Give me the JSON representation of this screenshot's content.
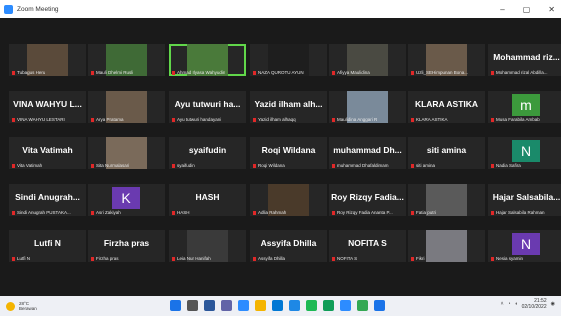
{
  "window": {
    "title": "Zoom Meeting",
    "controls": [
      "–",
      "▢",
      "✕"
    ]
  },
  "tiles": [
    {
      "big": "",
      "small": "Tubagus Heru",
      "video": "#5a4a3a"
    },
    {
      "big": "",
      "small": "Mauli Dhelmi Rusli",
      "video": "#3f6a36"
    },
    {
      "big": "",
      "small": "Ahmad Ilyasa Wahyudin",
      "video": "#4a7a3a",
      "active": true
    },
    {
      "big": "",
      "small": "NAZA QUROTU AYUN",
      "video": "#1e1e1e"
    },
    {
      "big": "",
      "small": "Afiyya Maulidina",
      "video": "#4a4a42"
    },
    {
      "big": "",
      "small": "Uzli_SEHimpunan Bona...",
      "video": "#6a5a4a"
    },
    {
      "big": "Mohammad riz...",
      "small": "Mohammad rizal Abdilla..."
    },
    {
      "big": "VINA WAHYU L...",
      "small": "VINA WAHYU LESTARI"
    },
    {
      "big": "",
      "small": "Arya Pratama",
      "video": "#6a5a4a"
    },
    {
      "big": "Ayu tutwuri ha...",
      "small": "Ayu tutwuri handayani"
    },
    {
      "big": "Yazid ilham alh...",
      "small": "Yazid ilham alhaqq"
    },
    {
      "big": "",
      "small": "Maulidina Anggari R",
      "video": "#7a8a9a"
    },
    {
      "big": "KLARA ASTIKA",
      "small": "KLARA ASTIKA"
    },
    {
      "big": "m",
      "small": "Musa Farabila Ambab",
      "avatar": "#3c9a3c"
    },
    {
      "big": "Vita Vatimah",
      "small": "Vita Vatimah"
    },
    {
      "big": "",
      "small": "Sita Nurmalasari",
      "video": "#7a6a5a"
    },
    {
      "big": "syaifudin",
      "small": "syaifudin"
    },
    {
      "big": "Roqi Wildana",
      "small": "Roqi Wildana"
    },
    {
      "big": "muhammad Dh...",
      "small": "muhammad Dhafaldimam"
    },
    {
      "big": "siti amina",
      "small": "siti amina"
    },
    {
      "big": "N",
      "small": "Nadia Safira",
      "avatar": "#1a8a6a"
    },
    {
      "big": "Sindi Anugrah...",
      "small": "Sindi Anugrah PUSTAKA..."
    },
    {
      "big": "K",
      "small": "Asri Zakiyah",
      "avatar": "#6a3ab0"
    },
    {
      "big": "HASH",
      "small": "HASH"
    },
    {
      "big": "",
      "small": "Adlia Rahmah",
      "video": "#4a3a2a"
    },
    {
      "big": "Roy Rizqy Fadia...",
      "small": "Roy Rizqy Fadia Ananta P..."
    },
    {
      "big": "",
      "small": "Fatia putri",
      "video": "#5a5a5a"
    },
    {
      "big": "Hajar Salsabila...",
      "small": "Hajar Salsabila Rahman"
    },
    {
      "big": "Lutfi N",
      "small": "Lutfi N"
    },
    {
      "big": "Firzha pras",
      "small": "Firzha pras"
    },
    {
      "big": "",
      "small": "Leia Nur Hanifah",
      "video": "#3a3a3a"
    },
    {
      "big": "Assyifa Dhilla",
      "small": "Assyifa Dhilla"
    },
    {
      "big": "NOFITA S",
      "small": "NOFITA S"
    },
    {
      "big": "",
      "small": "Fikri",
      "video": "#7a7a80"
    },
    {
      "big": "N",
      "small": "Nesia syamin",
      "avatar": "#6a3ab0"
    }
  ],
  "taskbar": {
    "weather_temp": "28°C",
    "weather_text": "Berawan",
    "time": "21:52",
    "date": "02/10/2022",
    "icon_colors": [
      "#1a73e8",
      "#555555",
      "#2b579a",
      "#6264a7",
      "#2d8cff",
      "#f4b400",
      "#0078d4",
      "#1e88e5",
      "#1db954",
      "#0f9d58",
      "#2d8cff",
      "#34a853",
      "#1a73e8"
    ]
  }
}
